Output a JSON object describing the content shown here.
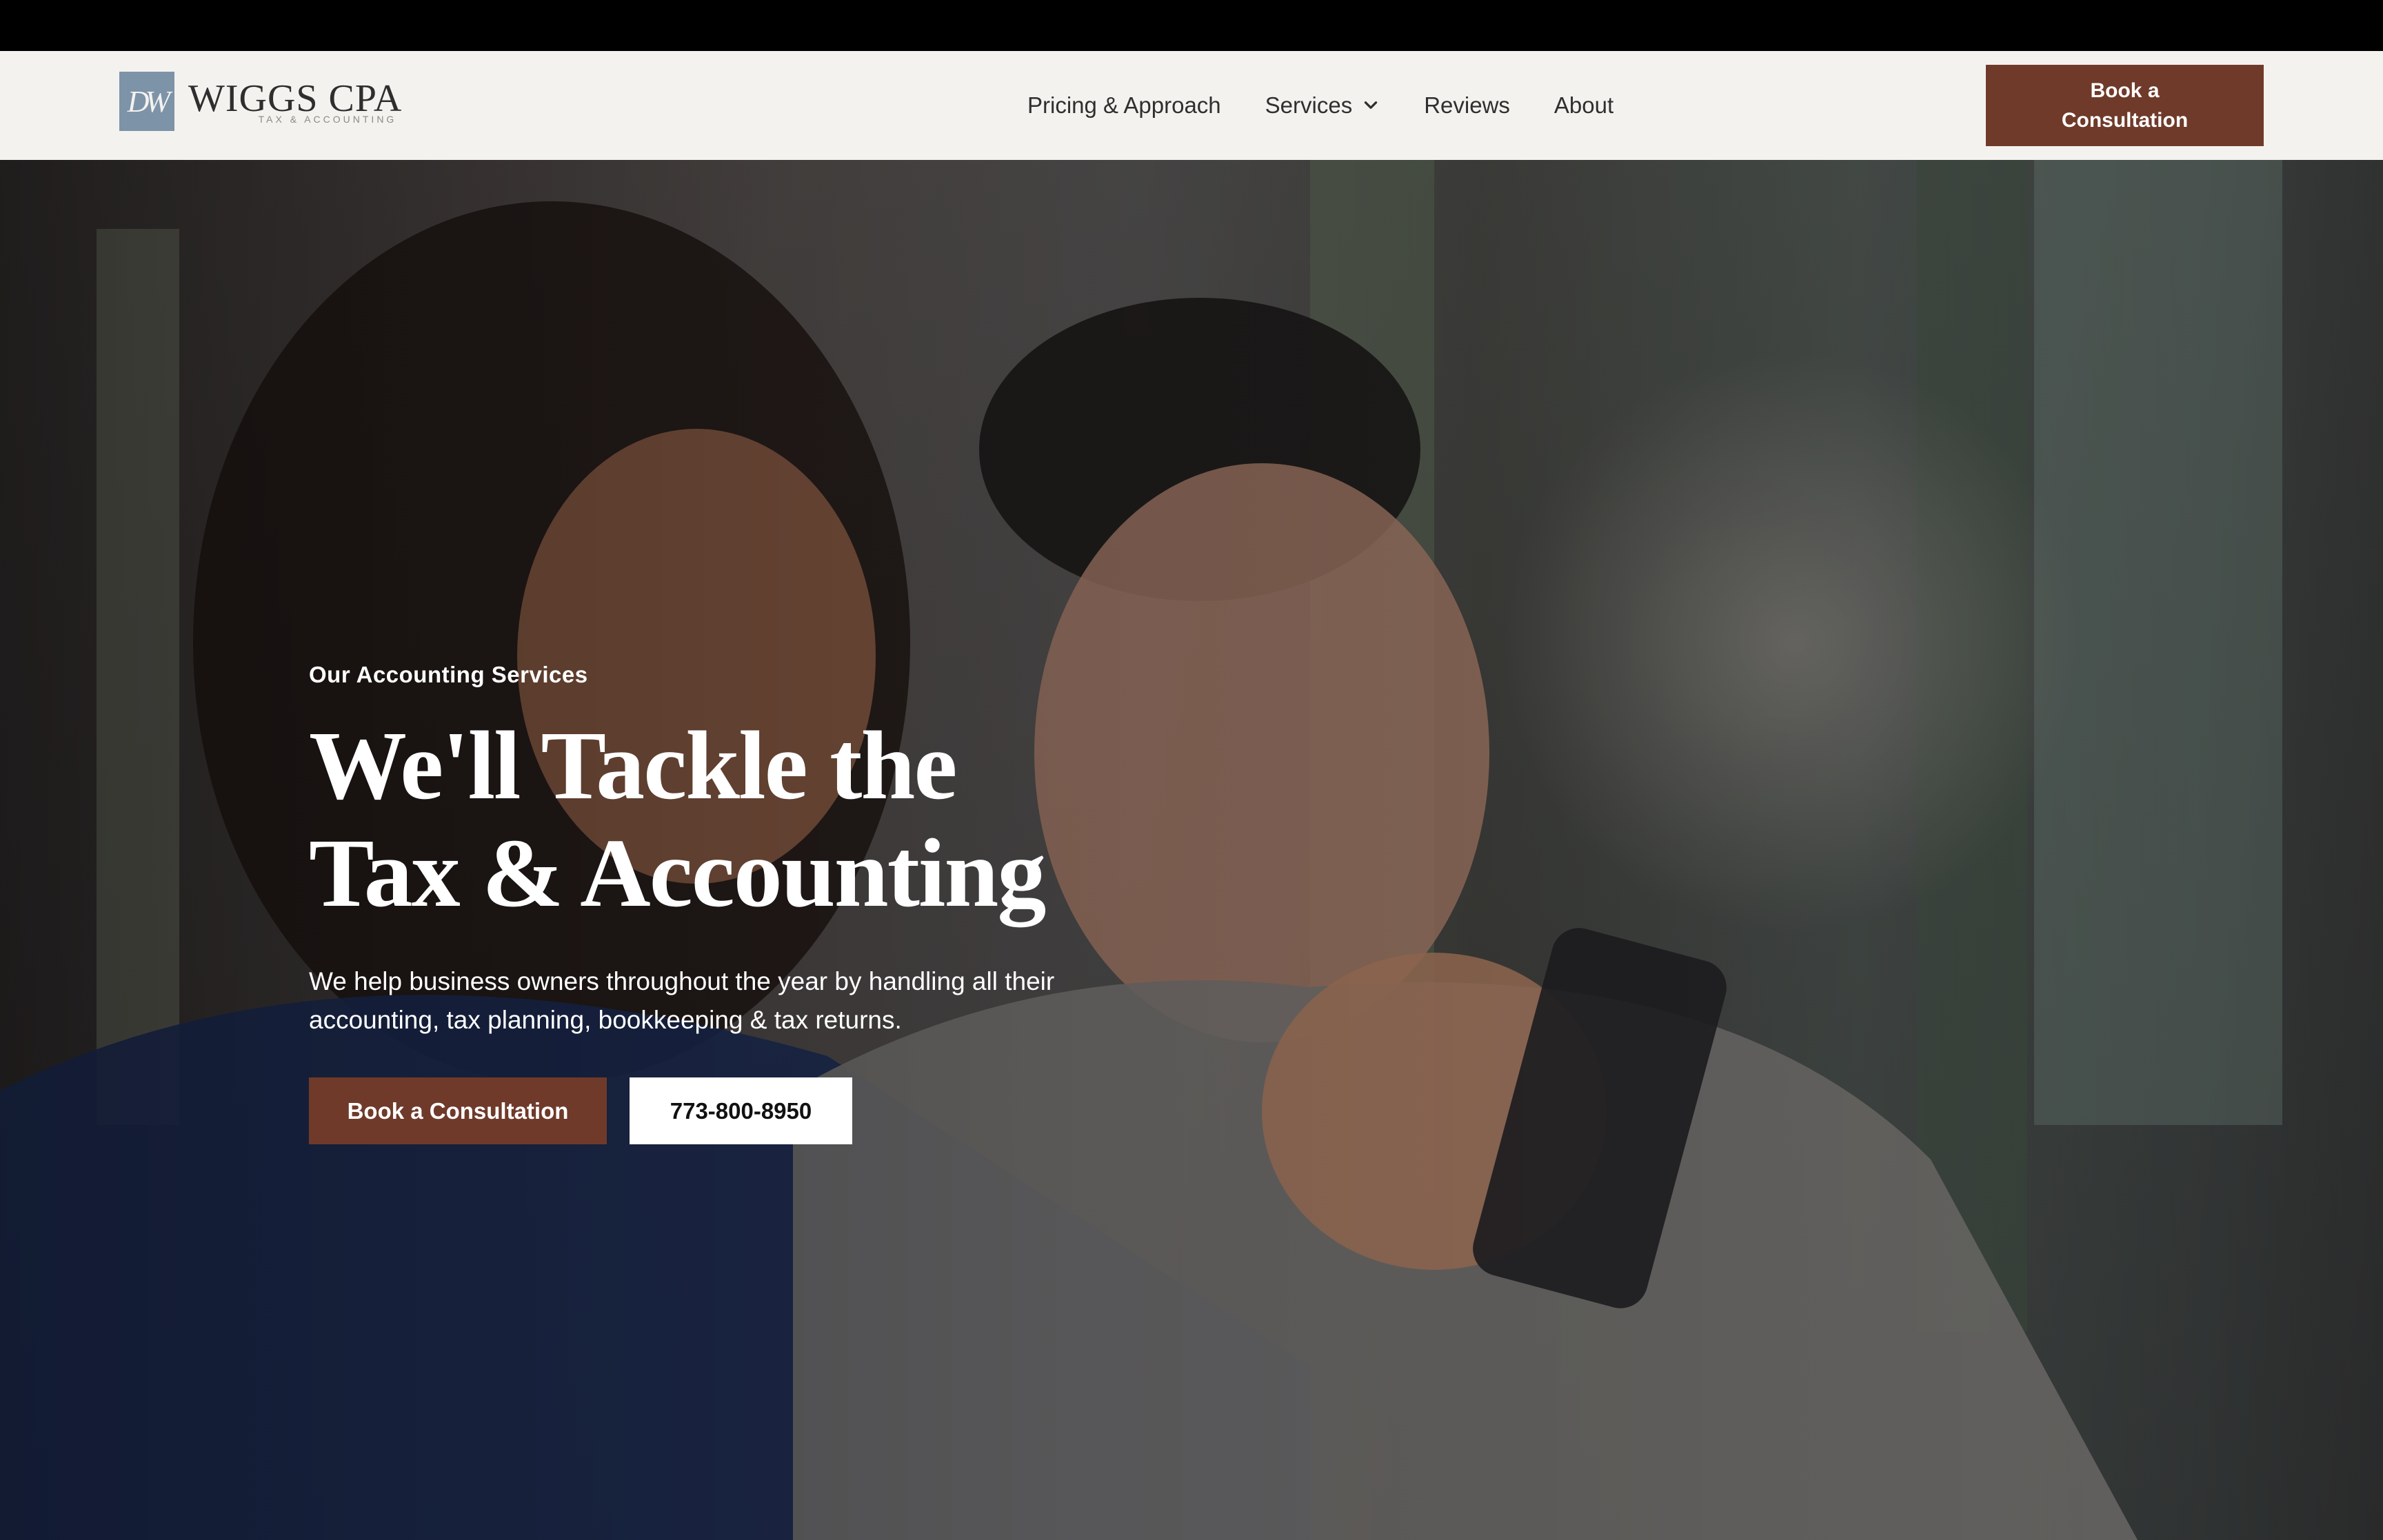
{
  "logo": {
    "monogram": "DW",
    "name": "WIGGS CPA",
    "tagline": "TAX & ACCOUNTING"
  },
  "nav": {
    "items": [
      {
        "label": "Pricing & Approach"
      },
      {
        "label": "Services",
        "icon": "chevron-down-icon"
      },
      {
        "label": "Reviews"
      },
      {
        "label": "About"
      }
    ],
    "cta_label": "Book a Consultation"
  },
  "hero": {
    "eyebrow": "Our Accounting Services",
    "headline_line1": "We'll Tackle the",
    "headline_line2": "Tax & Accounting",
    "subtext": "We help business owners throughout the year by handling all their accounting, tax planning, bookkeeping & tax returns.",
    "primary_button": "Book a Consultation",
    "phone_button": "773-800-8950"
  },
  "colors": {
    "brand_accent": "#6f3a2a",
    "logo_tile": "#7d93a8",
    "header_bg": "#f4f2ef"
  }
}
